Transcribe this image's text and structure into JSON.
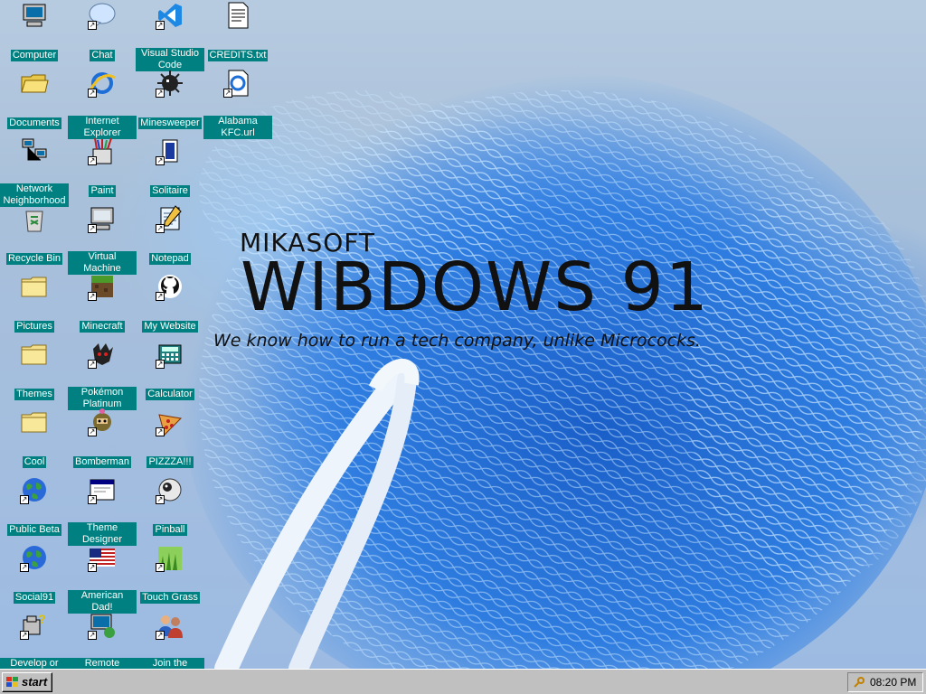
{
  "desktop": {
    "icons": [
      {
        "label": "Computer",
        "icon": "computer-icon",
        "shortcut": false
      },
      {
        "label": "Chat",
        "icon": "chat-bubble-icon",
        "shortcut": true
      },
      {
        "label": "Visual Studio Code",
        "icon": "vscode-icon",
        "shortcut": true
      },
      {
        "label": "CREDITS.txt",
        "icon": "text-file-icon",
        "shortcut": false
      },
      {
        "label": "Documents",
        "icon": "folder-open-icon",
        "shortcut": false
      },
      {
        "label": "Internet Explorer",
        "icon": "internet-explorer-icon",
        "shortcut": true
      },
      {
        "label": "Minesweeper",
        "icon": "mine-icon",
        "shortcut": true
      },
      {
        "label": "Alabama KFC.url",
        "icon": "ie-link-icon",
        "shortcut": true
      },
      {
        "label": "Network Neighborhood",
        "icon": "network-icon",
        "shortcut": false
      },
      {
        "label": "Paint",
        "icon": "paint-icon",
        "shortcut": true
      },
      {
        "label": "Solitaire",
        "icon": "cards-icon",
        "shortcut": true
      },
      {
        "label": "Recycle Bin",
        "icon": "recycle-bin-icon",
        "shortcut": false
      },
      {
        "label": "Virtual Machine",
        "icon": "virtual-machine-icon",
        "shortcut": true
      },
      {
        "label": "Notepad",
        "icon": "notepad-icon",
        "shortcut": true
      },
      {
        "label": "Pictures",
        "icon": "folder-icon",
        "shortcut": false
      },
      {
        "label": "Minecraft",
        "icon": "minecraft-block-icon",
        "shortcut": true
      },
      {
        "label": "My Website",
        "icon": "github-icon",
        "shortcut": true
      },
      {
        "label": "Themes",
        "icon": "folder-icon",
        "shortcut": false
      },
      {
        "label": "Pokémon Platinum",
        "icon": "pokemon-icon",
        "shortcut": true
      },
      {
        "label": "Calculator",
        "icon": "calculator-icon",
        "shortcut": true
      },
      {
        "label": "Cool",
        "icon": "folder-icon",
        "shortcut": false
      },
      {
        "label": "Bomberman",
        "icon": "bomberman-icon",
        "shortcut": true
      },
      {
        "label": "PIZZZA!!!",
        "icon": "pizza-icon",
        "shortcut": true
      },
      {
        "label": "Public Beta",
        "icon": "globe-icon",
        "shortcut": true
      },
      {
        "label": "Theme Designer",
        "icon": "window-icon",
        "shortcut": true
      },
      {
        "label": "Pinball",
        "icon": "pinball-icon",
        "shortcut": true
      },
      {
        "label": "Social91",
        "icon": "globe-icon",
        "shortcut": true
      },
      {
        "label": "American Dad!",
        "icon": "american-flag-icon",
        "shortcut": true
      },
      {
        "label": "Touch Grass",
        "icon": "grass-icon",
        "shortcut": true
      },
      {
        "label": "Develop or Install",
        "icon": "setup-icon",
        "shortcut": true
      },
      {
        "label": "Remote Desktop",
        "icon": "remote-desktop-icon",
        "shortcut": true
      },
      {
        "label": "Join the Community",
        "icon": "people-icon",
        "shortcut": true
      }
    ]
  },
  "wallpaper": {
    "brand_small": "MIKASOFT",
    "brand_big": "WIBDOWS 91",
    "tagline": "We know how to run a tech company, unlike Micrococks."
  },
  "taskbar": {
    "start_label": "start",
    "clock": "08:20 PM"
  },
  "colors": {
    "label_bg": "#008080",
    "taskbar": "#c0c0c0",
    "wallpaper_blue": "#2b72d6"
  }
}
